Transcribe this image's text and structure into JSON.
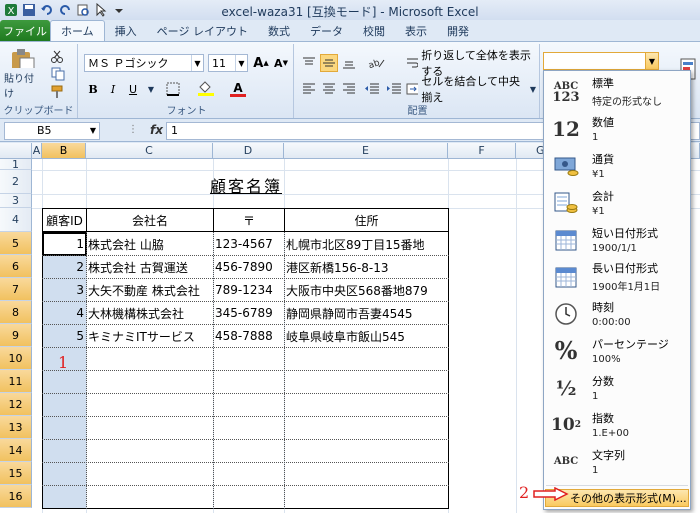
{
  "window": {
    "title": "excel-waza31 [互換モード] - Microsoft Excel"
  },
  "tabs": {
    "file": "ファイル",
    "items": [
      "ホーム",
      "挿入",
      "ページ レイアウト",
      "数式",
      "データ",
      "校閲",
      "表示",
      "開発"
    ]
  },
  "ribbon": {
    "paste_label": "貼り付け",
    "clipboard_label": "クリップボード",
    "font_name": "ＭＳ Ｐゴシック",
    "font_size": "11",
    "font_group_label": "フォント",
    "wrap_text": "折り返して全体を表示する",
    "merge_center": "セルを結合して中央揃え",
    "alignment_label": "配置",
    "number_format_value": ""
  },
  "formula_bar": {
    "name_box": "B5",
    "fx": "fx",
    "content": "1"
  },
  "sheet": {
    "columns": [
      "A",
      "B",
      "C",
      "D",
      "E",
      "F",
      "G"
    ],
    "rows": [
      "1",
      "2",
      "3",
      "4",
      "5",
      "6",
      "7",
      "8",
      "9",
      "10",
      "11",
      "12",
      "13",
      "14",
      "15",
      "16"
    ],
    "title": "顧客名簿",
    "headers": [
      "顧客ID",
      "会社名",
      "〒",
      "住所"
    ],
    "records": [
      {
        "id": "1",
        "company": "株式会社 山脇",
        "zip": "123-4567",
        "address": "札幌市北区89丁目15番地"
      },
      {
        "id": "2",
        "company": "株式会社 古賀運送",
        "zip": "456-7890",
        "address": "港区新橋156-8-13"
      },
      {
        "id": "3",
        "company": "大矢不動産 株式会社",
        "zip": "789-1234",
        "address": "大阪市中央区568番地879"
      },
      {
        "id": "4",
        "company": "大林機構株式会社",
        "zip": "345-6789",
        "address": "静岡県静岡市吾妻4545"
      },
      {
        "id": "5",
        "company": "キミナミITサービス",
        "zip": "458-7888",
        "address": "岐阜県岐阜市飯山545"
      }
    ]
  },
  "annotations": {
    "marker_1": "1",
    "marker_2": "2"
  },
  "number_format_dropdown": {
    "items": [
      {
        "icon": "ABC/123",
        "name": "標準",
        "example": "特定の形式なし"
      },
      {
        "icon": "12",
        "name": "数値",
        "example": "1"
      },
      {
        "icon": "currency-icon",
        "name": "通貨",
        "example": "¥1"
      },
      {
        "icon": "accounting-icon",
        "name": "会計",
        "example": " ¥1"
      },
      {
        "icon": "calendar-icon",
        "name": "短い日付形式",
        "example": "1900/1/1"
      },
      {
        "icon": "calendar-icon",
        "name": "長い日付形式",
        "example": "1900年1月1日"
      },
      {
        "icon": "clock-icon",
        "name": "時刻",
        "example": "0:00:00"
      },
      {
        "icon": "%",
        "name": "パーセンテージ",
        "example": "100%"
      },
      {
        "icon": "1/2",
        "name": "分数",
        "example": "1"
      },
      {
        "icon": "10²",
        "name": "指数",
        "example": "1.E+00"
      },
      {
        "icon": "ABC",
        "name": "文字列",
        "example": "1"
      }
    ],
    "more_label": "その他の表示形式(M)..."
  }
}
